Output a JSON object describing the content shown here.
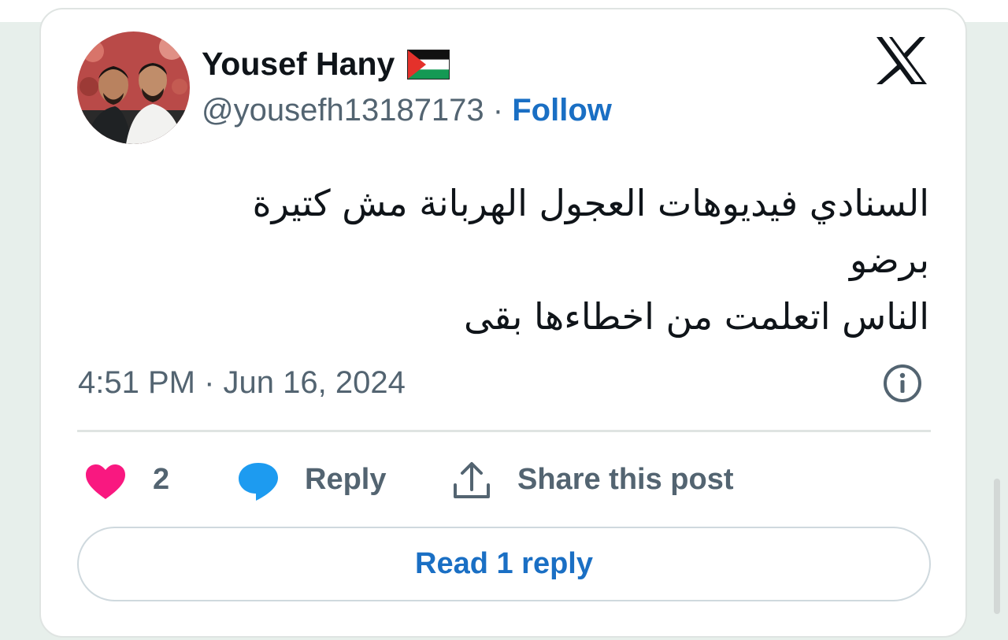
{
  "author": {
    "name": "Yousef Hany",
    "flag_icon": "palestine-flag-icon",
    "handle": "@yousefh13187173",
    "separator": "·",
    "follow_label": "Follow"
  },
  "platform_icon": "x-logo-icon",
  "tweet": {
    "lines": [
      "السنادي فيديوهات العجول الهربانة مش كتيرة",
      "برضو",
      "الناس اتعلمت من اخطاءها بقى"
    ],
    "timestamp": "4:51 PM · Jun 16, 2024"
  },
  "actions": {
    "likes": "2",
    "reply_label": "Reply",
    "share_label": "Share this post"
  },
  "read_replies_label": "Read 1 reply",
  "colors": {
    "like": "#f91880",
    "reply": "#1d9bf0",
    "link": "#1a6fc4",
    "secondary_text": "#536471",
    "primary_text": "#0f1419",
    "page_background": "#e7efeb"
  }
}
